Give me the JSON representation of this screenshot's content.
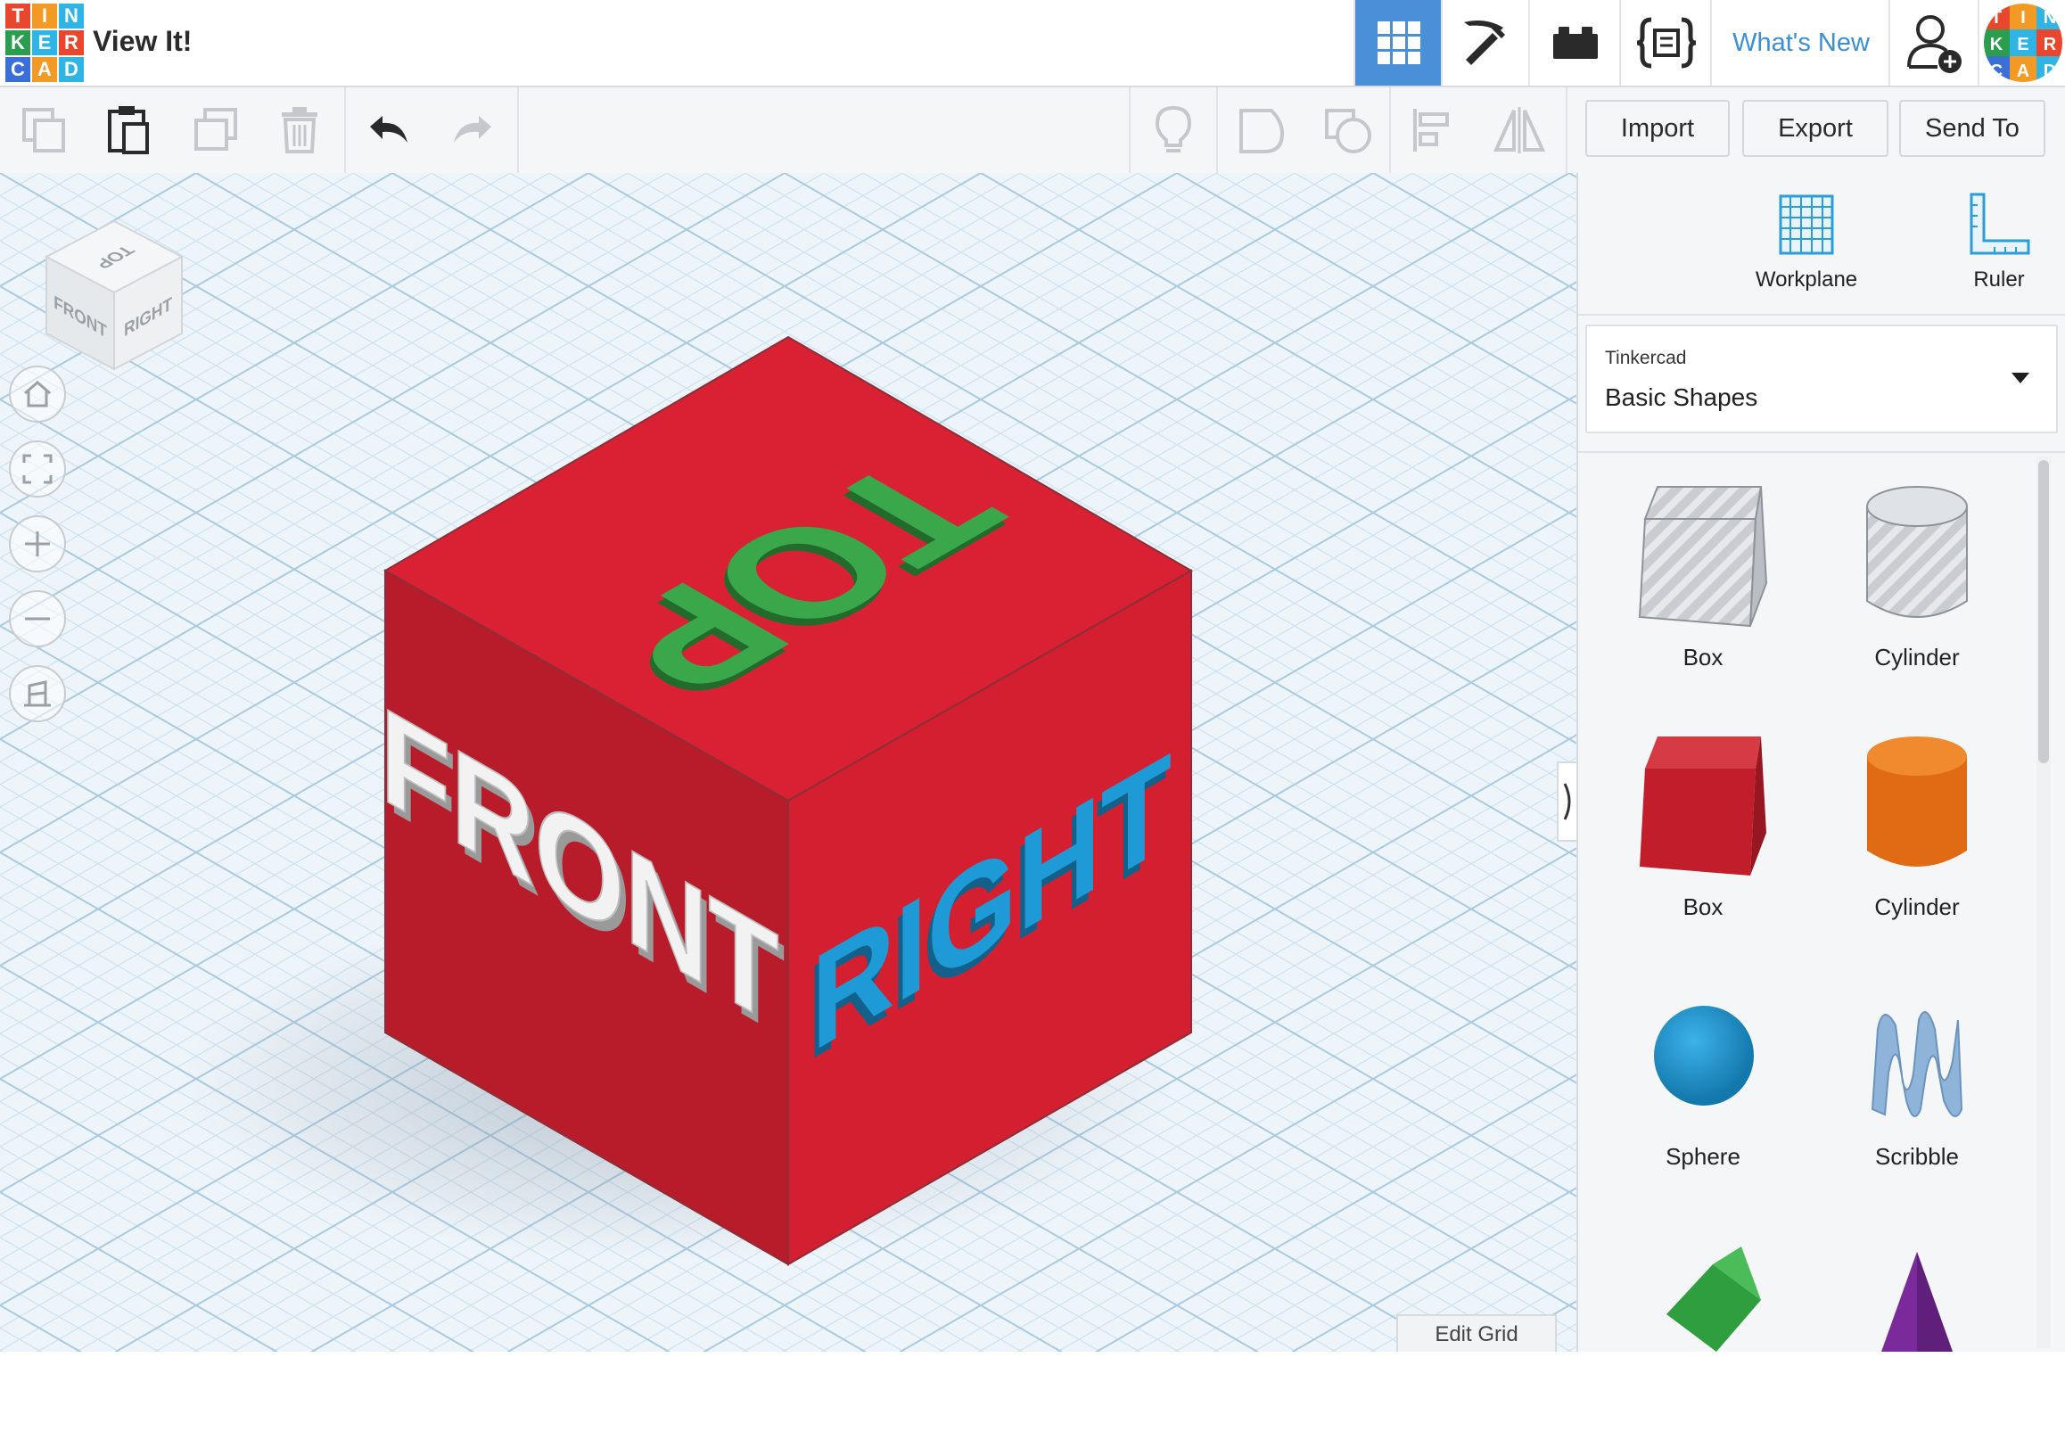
{
  "app": {
    "logo_letters": [
      "T",
      "I",
      "N",
      "K",
      "E",
      "R",
      "C",
      "A",
      "D"
    ],
    "logo_colors": [
      "#e8472d",
      "#f39a25",
      "#2eb5e5",
      "#2a9d4e",
      "#2eb5e5",
      "#e8472d",
      "#3a6fd8",
      "#f39a25",
      "#2eb5e5"
    ],
    "document_title": "View It!"
  },
  "nav": {
    "whats_new": "What's New",
    "avatar_letters": [
      "T",
      "I",
      "N",
      "K",
      "E",
      "R",
      "C",
      "A",
      "D"
    ]
  },
  "toolbar": {
    "import_label": "Import",
    "export_label": "Export",
    "send_to_label": "Send To"
  },
  "scene": {
    "cube_color": "#d41f30",
    "top_text": "TOP",
    "top_text_color": "#3aa84a",
    "front_text": "FRONT",
    "front_text_color": "#f2f2f2",
    "right_text": "RIGHT",
    "right_text_color": "#1e9ad6",
    "viewcube": {
      "top": "TOP",
      "front": "FRONT",
      "right": "RIGHT"
    },
    "edit_grid_label": "Edit Grid"
  },
  "panel": {
    "workplane_label": "Workplane",
    "ruler_label": "Ruler",
    "library_provider": "Tinkercad",
    "library_name": "Basic Shapes",
    "shapes": [
      {
        "label": "Box"
      },
      {
        "label": "Cylinder"
      },
      {
        "label": "Box"
      },
      {
        "label": "Cylinder"
      },
      {
        "label": "Sphere"
      },
      {
        "label": "Scribble"
      }
    ]
  },
  "colors": {
    "accent": "#4a90d9",
    "link": "#3a8fd6"
  }
}
